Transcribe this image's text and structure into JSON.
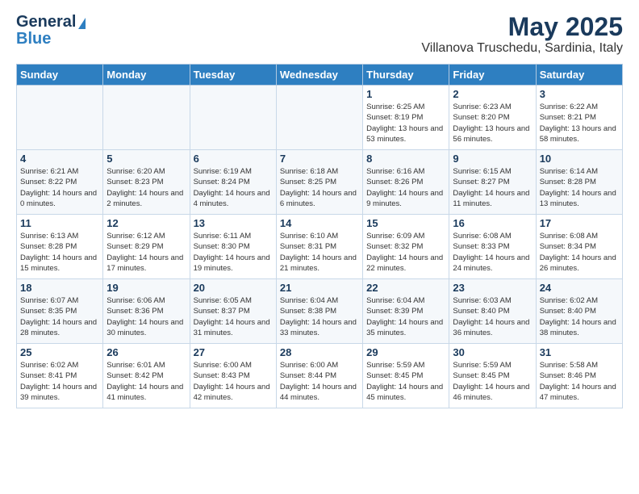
{
  "header": {
    "logo_line1": "General",
    "logo_line2": "Blue",
    "month": "May 2025",
    "location": "Villanova Truschedu, Sardinia, Italy"
  },
  "weekdays": [
    "Sunday",
    "Monday",
    "Tuesday",
    "Wednesday",
    "Thursday",
    "Friday",
    "Saturday"
  ],
  "weeks": [
    [
      {
        "day": "",
        "sunrise": "",
        "sunset": "",
        "daylight": ""
      },
      {
        "day": "",
        "sunrise": "",
        "sunset": "",
        "daylight": ""
      },
      {
        "day": "",
        "sunrise": "",
        "sunset": "",
        "daylight": ""
      },
      {
        "day": "",
        "sunrise": "",
        "sunset": "",
        "daylight": ""
      },
      {
        "day": "1",
        "sunrise": "Sunrise: 6:25 AM",
        "sunset": "Sunset: 8:19 PM",
        "daylight": "Daylight: 13 hours and 53 minutes."
      },
      {
        "day": "2",
        "sunrise": "Sunrise: 6:23 AM",
        "sunset": "Sunset: 8:20 PM",
        "daylight": "Daylight: 13 hours and 56 minutes."
      },
      {
        "day": "3",
        "sunrise": "Sunrise: 6:22 AM",
        "sunset": "Sunset: 8:21 PM",
        "daylight": "Daylight: 13 hours and 58 minutes."
      }
    ],
    [
      {
        "day": "4",
        "sunrise": "Sunrise: 6:21 AM",
        "sunset": "Sunset: 8:22 PM",
        "daylight": "Daylight: 14 hours and 0 minutes."
      },
      {
        "day": "5",
        "sunrise": "Sunrise: 6:20 AM",
        "sunset": "Sunset: 8:23 PM",
        "daylight": "Daylight: 14 hours and 2 minutes."
      },
      {
        "day": "6",
        "sunrise": "Sunrise: 6:19 AM",
        "sunset": "Sunset: 8:24 PM",
        "daylight": "Daylight: 14 hours and 4 minutes."
      },
      {
        "day": "7",
        "sunrise": "Sunrise: 6:18 AM",
        "sunset": "Sunset: 8:25 PM",
        "daylight": "Daylight: 14 hours and 6 minutes."
      },
      {
        "day": "8",
        "sunrise": "Sunrise: 6:16 AM",
        "sunset": "Sunset: 8:26 PM",
        "daylight": "Daylight: 14 hours and 9 minutes."
      },
      {
        "day": "9",
        "sunrise": "Sunrise: 6:15 AM",
        "sunset": "Sunset: 8:27 PM",
        "daylight": "Daylight: 14 hours and 11 minutes."
      },
      {
        "day": "10",
        "sunrise": "Sunrise: 6:14 AM",
        "sunset": "Sunset: 8:28 PM",
        "daylight": "Daylight: 14 hours and 13 minutes."
      }
    ],
    [
      {
        "day": "11",
        "sunrise": "Sunrise: 6:13 AM",
        "sunset": "Sunset: 8:28 PM",
        "daylight": "Daylight: 14 hours and 15 minutes."
      },
      {
        "day": "12",
        "sunrise": "Sunrise: 6:12 AM",
        "sunset": "Sunset: 8:29 PM",
        "daylight": "Daylight: 14 hours and 17 minutes."
      },
      {
        "day": "13",
        "sunrise": "Sunrise: 6:11 AM",
        "sunset": "Sunset: 8:30 PM",
        "daylight": "Daylight: 14 hours and 19 minutes."
      },
      {
        "day": "14",
        "sunrise": "Sunrise: 6:10 AM",
        "sunset": "Sunset: 8:31 PM",
        "daylight": "Daylight: 14 hours and 21 minutes."
      },
      {
        "day": "15",
        "sunrise": "Sunrise: 6:09 AM",
        "sunset": "Sunset: 8:32 PM",
        "daylight": "Daylight: 14 hours and 22 minutes."
      },
      {
        "day": "16",
        "sunrise": "Sunrise: 6:08 AM",
        "sunset": "Sunset: 8:33 PM",
        "daylight": "Daylight: 14 hours and 24 minutes."
      },
      {
        "day": "17",
        "sunrise": "Sunrise: 6:08 AM",
        "sunset": "Sunset: 8:34 PM",
        "daylight": "Daylight: 14 hours and 26 minutes."
      }
    ],
    [
      {
        "day": "18",
        "sunrise": "Sunrise: 6:07 AM",
        "sunset": "Sunset: 8:35 PM",
        "daylight": "Daylight: 14 hours and 28 minutes."
      },
      {
        "day": "19",
        "sunrise": "Sunrise: 6:06 AM",
        "sunset": "Sunset: 8:36 PM",
        "daylight": "Daylight: 14 hours and 30 minutes."
      },
      {
        "day": "20",
        "sunrise": "Sunrise: 6:05 AM",
        "sunset": "Sunset: 8:37 PM",
        "daylight": "Daylight: 14 hours and 31 minutes."
      },
      {
        "day": "21",
        "sunrise": "Sunrise: 6:04 AM",
        "sunset": "Sunset: 8:38 PM",
        "daylight": "Daylight: 14 hours and 33 minutes."
      },
      {
        "day": "22",
        "sunrise": "Sunrise: 6:04 AM",
        "sunset": "Sunset: 8:39 PM",
        "daylight": "Daylight: 14 hours and 35 minutes."
      },
      {
        "day": "23",
        "sunrise": "Sunrise: 6:03 AM",
        "sunset": "Sunset: 8:40 PM",
        "daylight": "Daylight: 14 hours and 36 minutes."
      },
      {
        "day": "24",
        "sunrise": "Sunrise: 6:02 AM",
        "sunset": "Sunset: 8:40 PM",
        "daylight": "Daylight: 14 hours and 38 minutes."
      }
    ],
    [
      {
        "day": "25",
        "sunrise": "Sunrise: 6:02 AM",
        "sunset": "Sunset: 8:41 PM",
        "daylight": "Daylight: 14 hours and 39 minutes."
      },
      {
        "day": "26",
        "sunrise": "Sunrise: 6:01 AM",
        "sunset": "Sunset: 8:42 PM",
        "daylight": "Daylight: 14 hours and 41 minutes."
      },
      {
        "day": "27",
        "sunrise": "Sunrise: 6:00 AM",
        "sunset": "Sunset: 8:43 PM",
        "daylight": "Daylight: 14 hours and 42 minutes."
      },
      {
        "day": "28",
        "sunrise": "Sunrise: 6:00 AM",
        "sunset": "Sunset: 8:44 PM",
        "daylight": "Daylight: 14 hours and 44 minutes."
      },
      {
        "day": "29",
        "sunrise": "Sunrise: 5:59 AM",
        "sunset": "Sunset: 8:45 PM",
        "daylight": "Daylight: 14 hours and 45 minutes."
      },
      {
        "day": "30",
        "sunrise": "Sunrise: 5:59 AM",
        "sunset": "Sunset: 8:45 PM",
        "daylight": "Daylight: 14 hours and 46 minutes."
      },
      {
        "day": "31",
        "sunrise": "Sunrise: 5:58 AM",
        "sunset": "Sunset: 8:46 PM",
        "daylight": "Daylight: 14 hours and 47 minutes."
      }
    ]
  ]
}
